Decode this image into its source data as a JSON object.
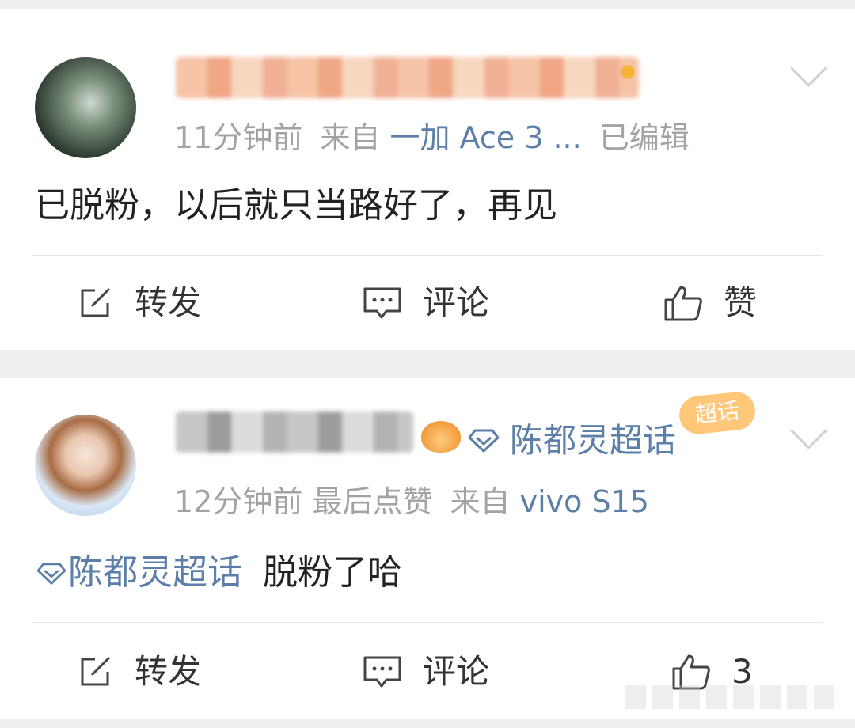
{
  "posts": [
    {
      "meta": {
        "time": "11分钟前",
        "from_label": "来自",
        "device": "一加 Ace 3 ...",
        "edited": "已编辑"
      },
      "content": "已脱粉，以后就只当路好了，再见",
      "actions": {
        "repost": "转发",
        "comment": "评论",
        "like": "赞"
      }
    },
    {
      "meta": {
        "time": "12分钟前",
        "last_like": "最后点赞",
        "from_label": "来自",
        "device": "vivo S15"
      },
      "supertopic": "陈都灵超话",
      "badge": "超话",
      "content_tag": "陈都灵超话",
      "content": "脱粉了哈",
      "actions": {
        "repost": "转发",
        "comment": "评论",
        "like": "3"
      }
    }
  ],
  "colors": {
    "link": "#5b7fa8",
    "meta": "#a3a3a3",
    "background": "#eeeeee"
  },
  "icons": [
    "repost-icon",
    "comment-icon",
    "thumbs-up-icon",
    "supertopic-diamond-icon",
    "chevron-down-icon"
  ]
}
